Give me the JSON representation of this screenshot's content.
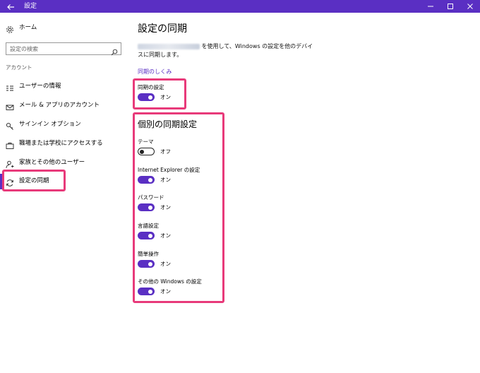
{
  "window": {
    "title": "設定"
  },
  "sidebar": {
    "home_label": "ホーム",
    "search_placeholder": "設定の検索",
    "section_label": "アカウント",
    "items": [
      {
        "label": "ユーザーの情報",
        "icon": "user-info-icon"
      },
      {
        "label": "メール & アプリのアカウント",
        "icon": "mail-icon"
      },
      {
        "label": "サインイン オプション",
        "icon": "key-icon"
      },
      {
        "label": "職場または学校にアクセスする",
        "icon": "briefcase-icon"
      },
      {
        "label": "家族とその他のユーザー",
        "icon": "person-add-icon"
      },
      {
        "label": "設定の同期",
        "icon": "sync-icon",
        "active": true
      }
    ]
  },
  "main": {
    "title": "設定の同期",
    "description_rest": " を使用して、Windows の設定を他のデバイスに同期します。",
    "link_label": "同期のしくみ",
    "sync_setting": {
      "label": "同期の設定",
      "state": "オン",
      "on": true
    },
    "individual_heading": "個別の同期設定",
    "individual": [
      {
        "label": "テーマ",
        "state": "オフ",
        "on": false
      },
      {
        "label": "Internet Explorer の設定",
        "state": "オン",
        "on": true
      },
      {
        "label": "パスワード",
        "state": "オン",
        "on": true
      },
      {
        "label": "言語設定",
        "state": "オン",
        "on": true
      },
      {
        "label": "簡単操作",
        "state": "オン",
        "on": true
      },
      {
        "label": "その他の Windows の設定",
        "state": "オン",
        "on": true
      }
    ]
  },
  "colors": {
    "accent": "#5a2fc3",
    "highlight": "#e83a7a"
  }
}
